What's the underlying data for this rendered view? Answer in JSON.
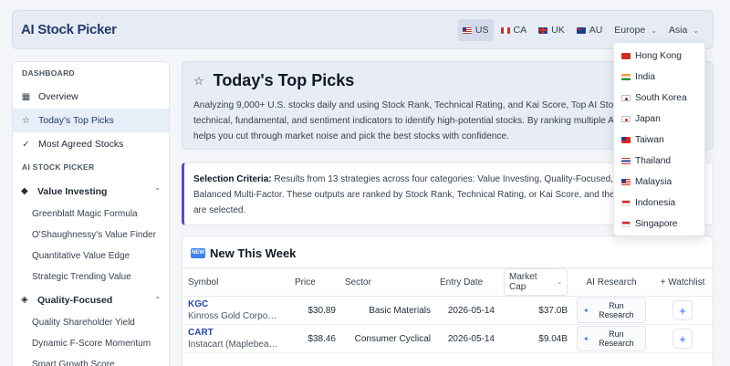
{
  "app": {
    "title": "AI Stock Picker"
  },
  "regions": [
    {
      "code": "US",
      "flag": "us"
    },
    {
      "code": "CA",
      "flag": "ca"
    },
    {
      "code": "UK",
      "flag": "uk"
    },
    {
      "code": "AU",
      "flag": "au"
    }
  ],
  "region_menus": {
    "europe": "Europe",
    "asia": "Asia"
  },
  "active_region": "US",
  "asia_dropdown": [
    {
      "label": "Hong Kong",
      "flag": "hk"
    },
    {
      "label": "India",
      "flag": "in"
    },
    {
      "label": "South Korea",
      "flag": "kr"
    },
    {
      "label": "Japan",
      "flag": "jp"
    },
    {
      "label": "Taiwan",
      "flag": "tw"
    },
    {
      "label": "Thailand",
      "flag": "th"
    },
    {
      "label": "Malaysia",
      "flag": "my"
    },
    {
      "label": "Indonesia",
      "flag": "id"
    },
    {
      "label": "Singapore",
      "flag": "sg"
    }
  ],
  "sidebar": {
    "dashboard_header": "DASHBOARD",
    "dashboard_items": [
      {
        "label": "Overview",
        "icon": "grid-icon"
      },
      {
        "label": "Today's Top Picks",
        "icon": "star-icon"
      },
      {
        "label": "Most Agreed Stocks",
        "icon": "check-circle-icon"
      }
    ],
    "picker_header": "AI STOCK PICKER",
    "groups": [
      {
        "label": "Value Investing",
        "icon": "gem-icon",
        "items": [
          "Greenblatt Magic Formula",
          "O'Shaughnessy's Value Finder",
          "Quantitative Value Edge",
          "Strategic Trending Value"
        ]
      },
      {
        "label": "Quality-Focused",
        "icon": "layers-icon",
        "items": [
          "Quality Shareholder Yield",
          "Dynamic F-Score Momentum",
          "Smart Growth Score"
        ]
      }
    ]
  },
  "hero": {
    "title": "Today's Top Picks",
    "description": "Analyzing 9,000+ U.S. stocks daily and using Stock Rank, Technical Rating, and Kai Score, Top AI Stock Picks hundreds of technical, fundamental, and sentiment indicators to identify high-potential stocks. By ranking multiple AI Stock Pickers, it helps you cut through market noise and pick the best stocks with confidence."
  },
  "criteria": {
    "label": "Selection Criteria:",
    "text": " Results from 13 strategies across four categories: Value Investing, Quality-Focused, Momentum, and Balanced Multi-Factor. These outputs are ranked by Stock Rank, Technical Rating, or Kai Score, and the top ranked stocks are selected."
  },
  "new_this_week": {
    "badge": "NEW",
    "title": "New This Week",
    "columns": {
      "symbol": "Symbol",
      "price": "Price",
      "sector": "Sector",
      "entry_date": "Entry Date",
      "market_cap": "Market Cap",
      "ai_research": "AI Research",
      "watchlist": "+ Watchlist"
    },
    "run_label": "Run Research",
    "rows": [
      {
        "symbol": "KGC",
        "name": "Kinross Gold Corporation",
        "price": "$30.89",
        "sector": "Basic Materials",
        "entry_date": "2026-05-14",
        "market_cap": "$37.0B"
      },
      {
        "symbol": "CART",
        "name": "Instacart (Maplebear Inc.)",
        "price": "$38.46",
        "sector": "Consumer Cyclical",
        "entry_date": "2026-05-14",
        "market_cap": "$9.04B"
      }
    ]
  }
}
